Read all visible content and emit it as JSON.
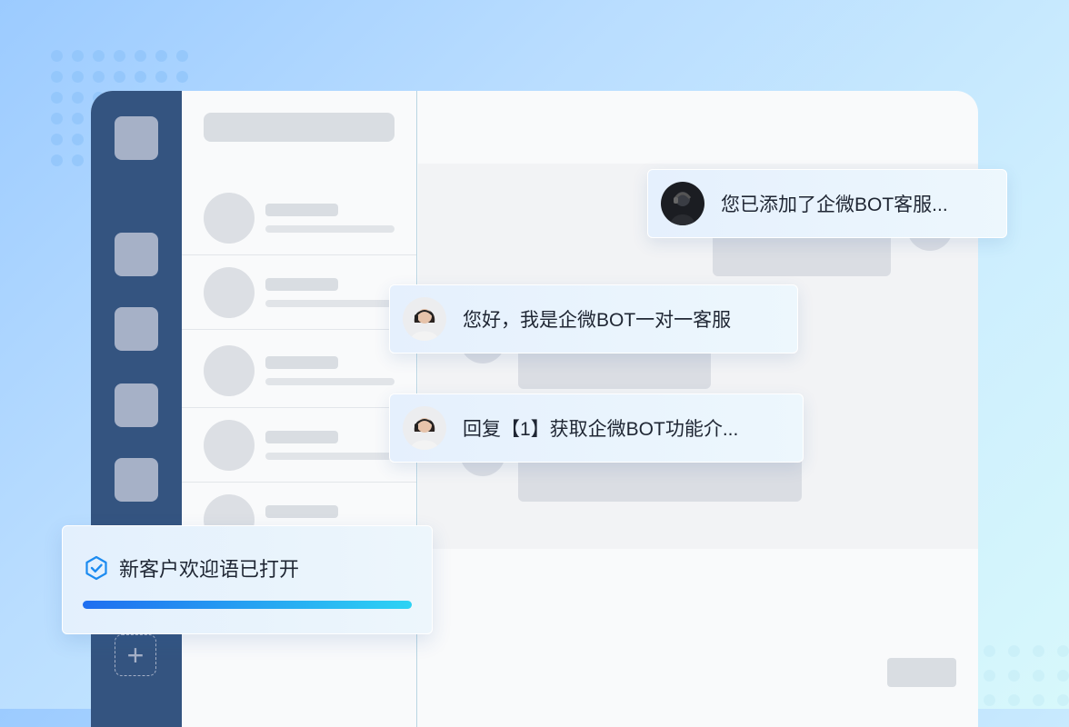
{
  "messages": [
    {
      "text": "您已添加了企微BOT客服...",
      "avatar": "agent-avatar-male"
    },
    {
      "text": "您好，我是企微BOT一对一客服",
      "avatar": "agent-avatar-female"
    },
    {
      "text": "回复【1】获取企微BOT功能介...",
      "avatar": "agent-avatar-female"
    }
  ],
  "toast": {
    "text": "新客户欢迎语已打开",
    "icon": "shield-check-icon",
    "progress": 1.0
  },
  "sidebar": {
    "add_icon": "plus-icon"
  },
  "colors": {
    "rail": "#345480",
    "accent_start": "#1f6ef0",
    "accent_end": "#2dd3f4",
    "check_icon": "#1c8bf0"
  }
}
